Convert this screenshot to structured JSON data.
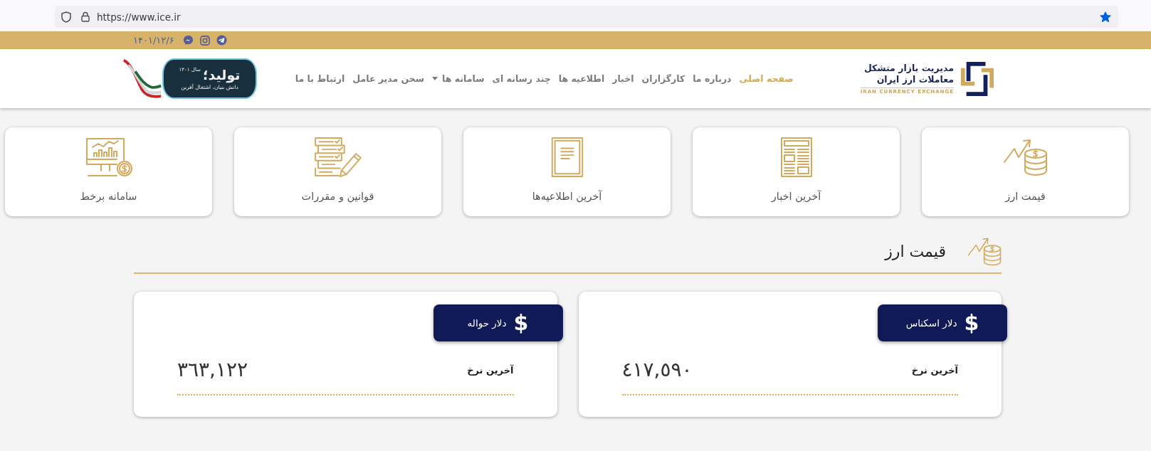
{
  "browser": {
    "url": "https://www.ice.ir",
    "bookmarked": true
  },
  "top_bar": {
    "date": "۱۴۰۱/۱۲/۶"
  },
  "header": {
    "logo": {
      "lines": [
        "مدیریت بازار متشکل",
        "معاملات ارز ایران"
      ],
      "tagline": "IRAN CURRENCY EXCHANGE"
    },
    "nav": [
      {
        "label": "صفحه اصلی",
        "selected": true,
        "dropdown": false
      },
      {
        "label": "درباره ما",
        "selected": false,
        "dropdown": false
      },
      {
        "label": "کارگزاران",
        "selected": false,
        "dropdown": false
      },
      {
        "label": "اخبار",
        "selected": false,
        "dropdown": false
      },
      {
        "label": "اطلاعیه ها",
        "selected": false,
        "dropdown": false
      },
      {
        "label": "چند رسانه ای",
        "selected": false,
        "dropdown": false
      },
      {
        "label": "سامانه ها",
        "selected": false,
        "dropdown": true
      },
      {
        "label": "سخن مدیر عامل",
        "selected": false,
        "dropdown": false
      },
      {
        "label": "ارتباط با ما",
        "selected": false,
        "dropdown": false
      }
    ],
    "banner": {
      "year": "سال ۱۴۰۱",
      "title": "تولید؛",
      "subtitle": "دانش بنیان، اشتغال آفرین"
    }
  },
  "shortcuts": [
    {
      "kind": "currency",
      "label": "قیمت ارز"
    },
    {
      "kind": "news",
      "label": "آخرین اخبار"
    },
    {
      "kind": "notices",
      "label": "آخرین اطلاعیه‌ها"
    },
    {
      "kind": "rules",
      "label": "قوانین و مقررات"
    },
    {
      "kind": "trading",
      "label": "سامانه برخط"
    }
  ],
  "rates_section": {
    "title": "قیمت ارز",
    "rates": [
      {
        "name": "دلار اسکناس",
        "symbol": "$",
        "caption": "آخرین نرخ",
        "value": "٤١٧,٥٩٠"
      },
      {
        "name": "دلار حواله",
        "symbol": "$",
        "caption": "آخرین نرخ",
        "value": "٣٦٣,١٢٢"
      }
    ]
  }
}
